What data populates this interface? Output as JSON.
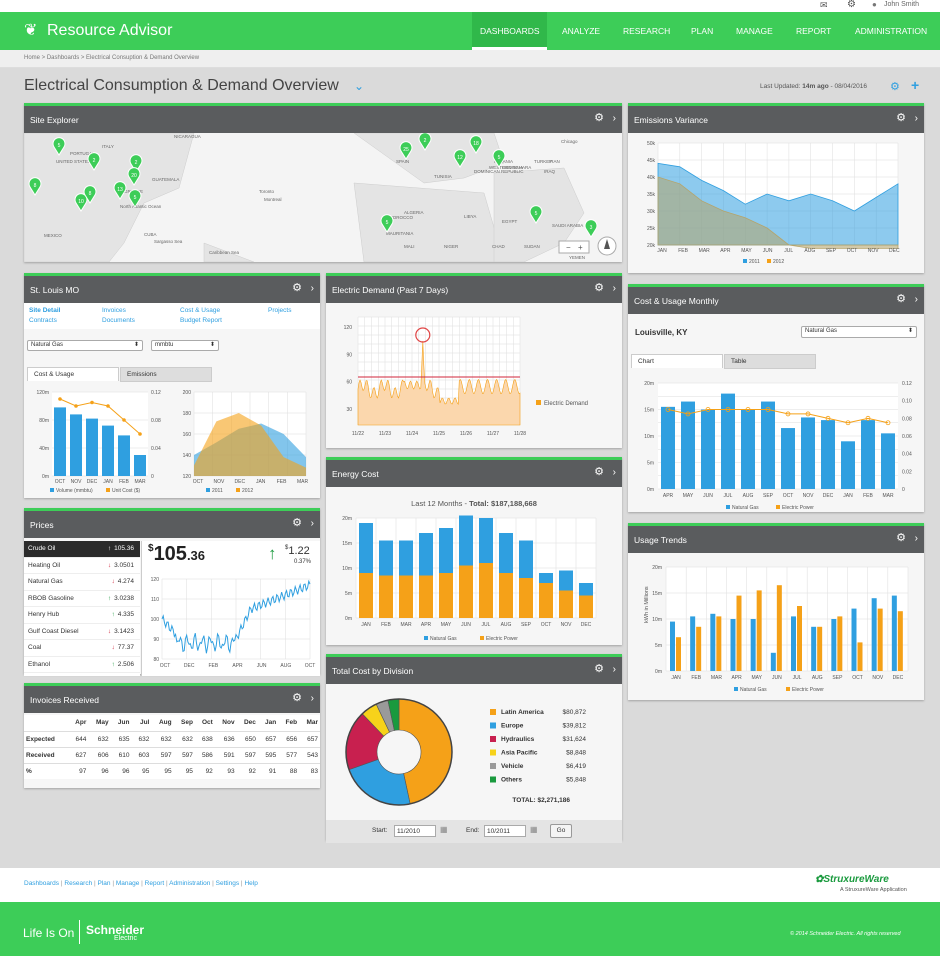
{
  "app": {
    "title": "Resource Advisor",
    "user": "John Smith"
  },
  "nav": [
    "DASHBOARDS",
    "ANALYZE",
    "RESEARCH",
    "PLAN",
    "MANAGE",
    "REPORT",
    "ADMINISTRATION"
  ],
  "breadcrumb": "Home  >  Dashboards  >  Electrical Consuption & Demand Overview",
  "page": {
    "title": "Electrical Consumption & Demand Overview",
    "updated_prefix": "Last Updated:",
    "updated_ago": "14m ago",
    "updated_date": " -  08/04/2016"
  },
  "site_explorer": {
    "title": "Site Explorer",
    "map_labels": [
      "UNITED STATES",
      "MEXICO",
      "CUBA",
      "SPAIN",
      "MOROCCO",
      "ALGERIA",
      "LIBYA",
      "EGYPT",
      "TURKEY",
      "SAUDI ARABIA",
      "MAURITANIA",
      "MALI",
      "NIGER",
      "CHAD",
      "SUDAN",
      "YEMEN",
      "TUNISIA",
      "WESTERN SAHARA",
      "GREECE",
      "ALBANIA",
      "GEORGIA",
      "North Atlantic Ocean",
      "Sargasso Sea",
      "Caribbean Sea",
      "DOMINICAN REPUBLIC",
      "GUATEMALA",
      "NICARAGUA",
      "ITALY",
      "PORTUGAL",
      "Toronto",
      "Montreal",
      "Chicago",
      "IRAN",
      "IRAQ"
    ],
    "pins": [
      "5",
      "2",
      "2",
      "20",
      "8",
      "13",
      "10",
      "5",
      "5",
      "25",
      "2",
      "12",
      "18",
      "5",
      "5",
      "8",
      "3"
    ]
  },
  "st_louis": {
    "title": "St. Louis MO",
    "links": [
      "Site Detail",
      "Invoices",
      "Cost & Usage",
      "Projects",
      "Contracts",
      "Documents",
      "Budget Report"
    ],
    "select1": "Natural Gas",
    "select2": "mmbtu",
    "tabs": [
      "Cost & Usage",
      "Emissions"
    ],
    "chart1": {
      "months": [
        "OCT",
        "NOV",
        "DEC",
        "JAN",
        "FEB",
        "MAR"
      ],
      "bars": [
        98,
        88,
        82,
        72,
        58,
        30
      ],
      "line": [
        0.11,
        0.1,
        0.105,
        0.1,
        0.08,
        0.06
      ],
      "yl": [
        "120m",
        "80m",
        "40m",
        "0m"
      ],
      "yr": [
        "0.12",
        "0.08",
        "0.04",
        "0"
      ],
      "legend": [
        "Volume (mmbtu)",
        "Unit Cost ($)"
      ]
    },
    "chart2": {
      "months": [
        "OCT",
        "NOV",
        "DEC",
        "JAN",
        "FEB",
        "MAR"
      ],
      "y": [
        "200",
        "180",
        "160",
        "140",
        "120"
      ],
      "s2011": [
        140,
        152,
        165,
        170,
        160,
        138
      ],
      "s2012": [
        130,
        172,
        180,
        168,
        138,
        128
      ],
      "legend": [
        "2011",
        "2012"
      ]
    }
  },
  "prices": {
    "title": "Prices",
    "items": [
      {
        "name": "Crude Oil",
        "arrow": "↑",
        "value": "105.36"
      },
      {
        "name": "Heating Oil",
        "arrow": "↓",
        "value": "3.0501"
      },
      {
        "name": "Natural Gas",
        "arrow": "↓",
        "value": "4.274"
      },
      {
        "name": "RBOB Gasoline",
        "arrow": "↑",
        "value": "3.0238"
      },
      {
        "name": "Henry Hub",
        "arrow": "↑",
        "value": "4.335"
      },
      {
        "name": "Gulf Coast Diesel",
        "arrow": "↓",
        "value": "3.1423"
      },
      {
        "name": "Coal",
        "arrow": "↓",
        "value": "77.37"
      },
      {
        "name": "Ethanol",
        "arrow": "↑",
        "value": "2.506"
      }
    ],
    "big_dollar": "$",
    "big_int": "105",
    "big_dec": ".36",
    "change": "1.22",
    "change_cur": "$",
    "change_pct": "0.37%",
    "chart": {
      "y": [
        "120",
        "110",
        "100",
        "90",
        "80"
      ],
      "x": [
        "OCT",
        "DEC",
        "FEB",
        "APR",
        "JUN",
        "AUG",
        "OCT"
      ]
    }
  },
  "invoices": {
    "title": "Invoices Received",
    "months": [
      "Apr",
      "May",
      "Jun",
      "Jul",
      "Aug",
      "Sep",
      "Oct",
      "Nov",
      "Dec",
      "Jan",
      "Feb",
      "Mar"
    ],
    "rows": [
      {
        "label": "Expected",
        "values": [
          "644",
          "632",
          "635",
          "632",
          "632",
          "632",
          "638",
          "636",
          "650",
          "657",
          "656",
          "657"
        ]
      },
      {
        "label": "Received",
        "values": [
          "627",
          "606",
          "610",
          "603",
          "597",
          "597",
          "586",
          "591",
          "597",
          "595",
          "577",
          "543"
        ]
      },
      {
        "label": "%",
        "values": [
          "97",
          "96",
          "96",
          "95",
          "95",
          "95",
          "92",
          "93",
          "92",
          "91",
          "88",
          "83"
        ]
      }
    ]
  },
  "demand": {
    "title": "Electric Demand (Past 7 Days)",
    "y": [
      "120",
      "90",
      "60",
      "30"
    ],
    "x": [
      "11/22",
      "11/23",
      "11/24",
      "11/25",
      "11/26",
      "11/27",
      "11/28"
    ],
    "legend": "Electric Demand"
  },
  "energy": {
    "title": "Energy Cost",
    "sub_prefix": "Last 12 Months - ",
    "sub_total": "Total: $187,188,668",
    "months": [
      "JAN",
      "FEB",
      "MAR",
      "APR",
      "MAY",
      "JUN",
      "JUL",
      "AUG",
      "SEP",
      "OCT",
      "NOV",
      "DEC"
    ],
    "gas": [
      9,
      8.5,
      8.5,
      8.5,
      9,
      10.5,
      11,
      9,
      8,
      7,
      5.5,
      4.5
    ],
    "power": [
      10,
      7,
      7,
      8.5,
      9,
      10,
      9,
      8,
      7.5,
      2,
      4,
      2.5
    ],
    "y": [
      "20m",
      "15m",
      "10m",
      "5m",
      "0m"
    ],
    "legend": [
      "Natural Gas",
      "Electric Power"
    ]
  },
  "division": {
    "title": "Total Cost by Division",
    "items": [
      {
        "name": "Latin America",
        "value": "$80,872",
        "color": "#f5a118"
      },
      {
        "name": "Europe",
        "value": "$39,812",
        "color": "#2f9fe0"
      },
      {
        "name": "Hydraulics",
        "value": "$31,624",
        "color": "#c8204f"
      },
      {
        "name": "Asia Pacific",
        "value": "$8,848",
        "color": "#f7d21a"
      },
      {
        "name": "Vehicle",
        "value": "$6,419",
        "color": "#9a9a9a"
      },
      {
        "name": "Others",
        "value": "$5,848",
        "color": "#1a9a3e"
      }
    ],
    "total": "TOTAL: $2,271,186",
    "start_label": "Start:",
    "start": "11/2010",
    "end_label": "End:",
    "end": "10/2011",
    "go": "Go"
  },
  "emissions": {
    "title": "Emissions Variance",
    "y": [
      "50k",
      "45k",
      "40k",
      "35k",
      "30k",
      "25k",
      "20k"
    ],
    "months": [
      "JAN",
      "FEB",
      "MAR",
      "APR",
      "MAY",
      "JUN",
      "JUL",
      "AUG",
      "SEP",
      "OCT",
      "NOV",
      "DEC"
    ],
    "s2011": [
      44,
      43,
      39,
      36,
      32,
      35,
      33,
      35,
      33,
      30,
      34,
      38
    ],
    "s2012": [
      40,
      38,
      33,
      30,
      28,
      25,
      20,
      19,
      19,
      19,
      19,
      19
    ],
    "legend": [
      "2011",
      "2012"
    ]
  },
  "cost_usage": {
    "title": "Cost & Usage Monthly",
    "location": "Louisville, KY",
    "select": "Natural Gas",
    "tabs": [
      "Chart",
      "Table"
    ],
    "months": [
      "APR",
      "MAY",
      "JUN",
      "JUL",
      "AUG",
      "SEP",
      "OCT",
      "NOV",
      "DEC",
      "JAN",
      "FEB",
      "MAR"
    ],
    "bars": [
      15.5,
      16.5,
      15,
      18,
      15,
      16.5,
      11.5,
      13.5,
      13,
      9,
      13,
      10.5
    ],
    "line": [
      0.09,
      0.085,
      0.09,
      0.09,
      0.09,
      0.09,
      0.085,
      0.085,
      0.08,
      0.075,
      0.08,
      0.075
    ],
    "yl": [
      "20m",
      "15m",
      "10m",
      "5m",
      "0m"
    ],
    "yr": [
      "0.12",
      "0.10",
      "0.08",
      "0.06",
      "0.04",
      "0.02",
      "0"
    ],
    "legend": [
      "Natural Gas",
      "Electric Power"
    ]
  },
  "usage_trends": {
    "title": "Usage Trends",
    "ylabel": "kWh in Millions",
    "y": [
      "20m",
      "15m",
      "10m",
      "5m",
      "0m"
    ],
    "months": [
      "JAN",
      "FEB",
      "MAR",
      "APR",
      "MAY",
      "JUN",
      "JUL",
      "AUG",
      "SEP",
      "OCT",
      "NOV",
      "DEC"
    ],
    "gas": [
      9.5,
      10.5,
      11,
      10,
      10,
      3.5,
      10.5,
      8.5,
      10,
      12,
      14,
      14.5
    ],
    "power": [
      6.5,
      8.5,
      10.5,
      14.5,
      15.5,
      16.5,
      12.5,
      8.5,
      10.5,
      5.5,
      12,
      11.5
    ],
    "legend": [
      "Natural Gas",
      "Electric Power"
    ]
  },
  "footer": {
    "links": [
      "Dashboards",
      "Research",
      "Plan",
      "Manage",
      "Report",
      "Administration",
      "Settings",
      "Help"
    ],
    "brand": "StruxureWare",
    "brand_sub": "A StruxureWare Application",
    "tagline": "Life Is On",
    "company": "Schneider",
    "company2": "Electric",
    "copyright": "© 2014 Schneider Electric. All rights reserved"
  },
  "colors": {
    "green": "#3dcd58",
    "blue": "#2f9fe0",
    "orange": "#f5a118",
    "header": "#5a5c5e"
  }
}
